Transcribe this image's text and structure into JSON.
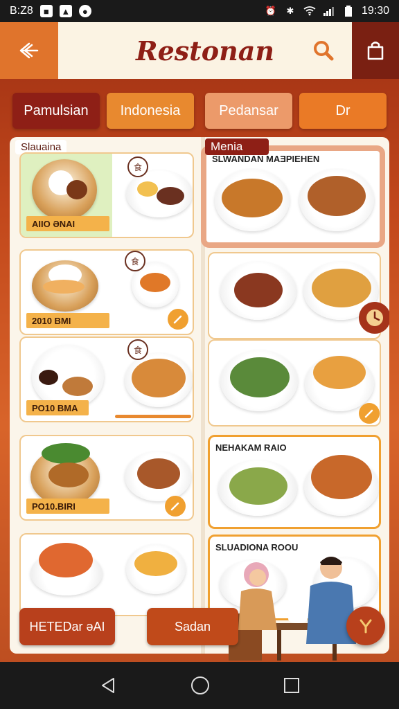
{
  "status_bar": {
    "time_left": "B:Z8",
    "time_right": "19:30"
  },
  "header": {
    "title": "Restonan"
  },
  "tabs": [
    {
      "label": "Pamulsian"
    },
    {
      "label": "Indonesia"
    },
    {
      "label": "Pedansar"
    },
    {
      "label": "Dr"
    }
  ],
  "left_column": {
    "section_label": "Slauaina",
    "cards": [
      {
        "price": "AIIO ƏNAI"
      },
      {
        "price": "2010 BMI"
      },
      {
        "price": "PO10 BMA"
      },
      {
        "price": "PO10.BIRI"
      },
      {
        "price": ""
      }
    ]
  },
  "right_column": {
    "section_label": "Menia",
    "cards": [
      {
        "title": "SLWANDAN MAƎPIEHEN"
      },
      {
        "title": ""
      },
      {
        "title": ""
      },
      {
        "title": "NEHAKAM RAIO"
      },
      {
        "title": "SLUADIONA ROOU"
      }
    ]
  },
  "actions": {
    "left_button": "HETEDar əAI",
    "middle_button": "Sadan"
  },
  "colors": {
    "primary": "#8e1f16",
    "accent": "#e8892f",
    "background": "#c2481c"
  }
}
